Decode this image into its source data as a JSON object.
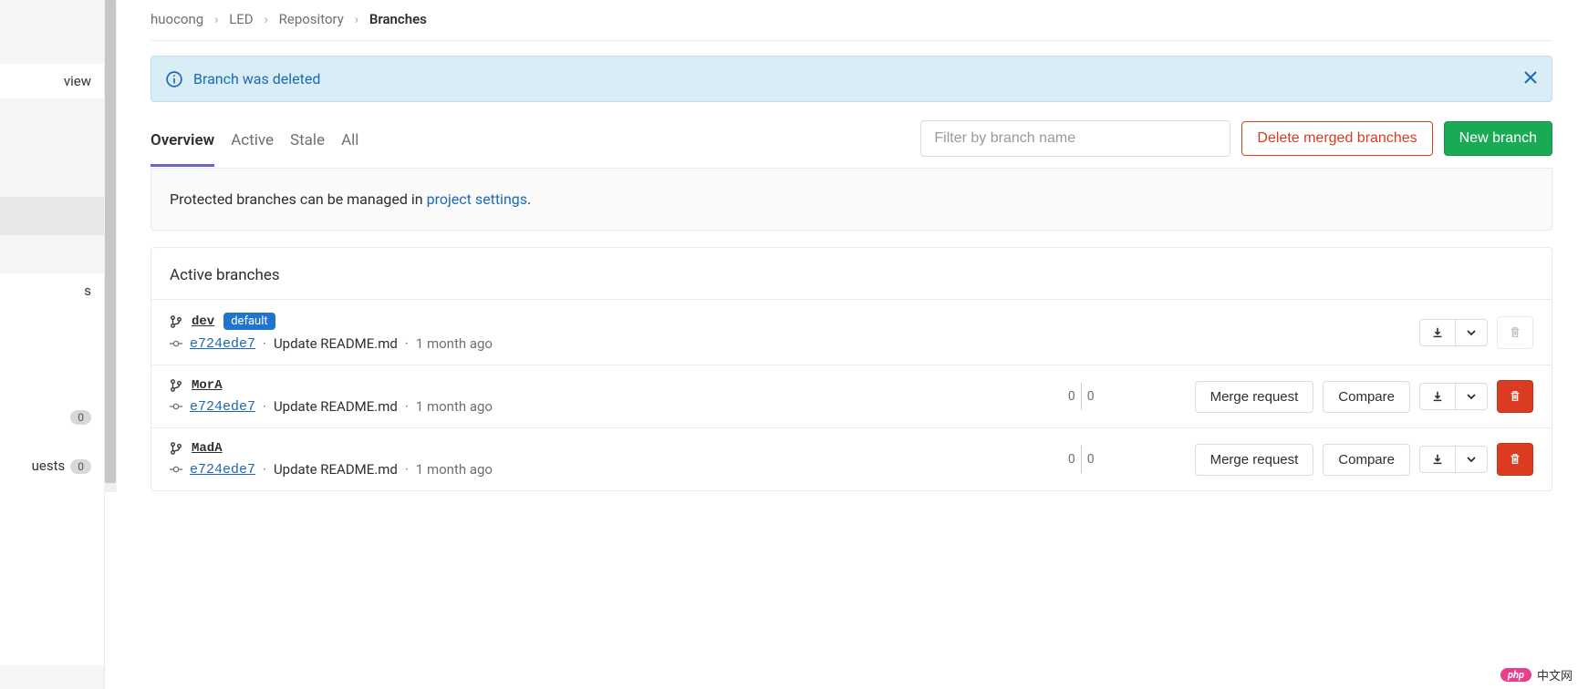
{
  "sidebar": {
    "items": [
      {
        "label": "view"
      },
      {
        "label": ""
      },
      {
        "label": ""
      },
      {
        "label": ""
      },
      {
        "label": "s"
      },
      {
        "label": ""
      },
      {
        "label": "",
        "badge": "0"
      },
      {
        "label": "uests",
        "badge": "0"
      }
    ]
  },
  "breadcrumb": {
    "items": [
      "huocong",
      "LED",
      "Repository"
    ],
    "current": "Branches"
  },
  "alert": {
    "message": "Branch was deleted"
  },
  "tabs": {
    "items": [
      "Overview",
      "Active",
      "Stale",
      "All"
    ],
    "active_index": 0
  },
  "toolbar": {
    "filter_placeholder": "Filter by branch name",
    "delete_merged_label": "Delete merged branches",
    "new_branch_label": "New branch"
  },
  "info": {
    "prefix": "Protected branches can be managed in ",
    "link": "project settings",
    "suffix": "."
  },
  "branches": {
    "header": "Active branches",
    "merge_request_label": "Merge request",
    "compare_label": "Compare",
    "items": [
      {
        "name": "dev",
        "default": true,
        "default_label": "default",
        "sha": "e724ede7",
        "message": "Update README.md",
        "time": "1 month ago",
        "behind": null,
        "ahead": null,
        "can_merge": false,
        "can_compare": false,
        "can_delete": false
      },
      {
        "name": "MorA",
        "default": false,
        "sha": "e724ede7",
        "message": "Update README.md",
        "time": "1 month ago",
        "behind": "0",
        "ahead": "0",
        "can_merge": true,
        "can_compare": true,
        "can_delete": true
      },
      {
        "name": "MadA",
        "default": false,
        "sha": "e724ede7",
        "message": "Update README.md",
        "time": "1 month ago",
        "behind": "0",
        "ahead": "0",
        "can_merge": true,
        "can_compare": true,
        "can_delete": true
      }
    ]
  },
  "watermark": {
    "badge": "php",
    "text": "中文网"
  }
}
